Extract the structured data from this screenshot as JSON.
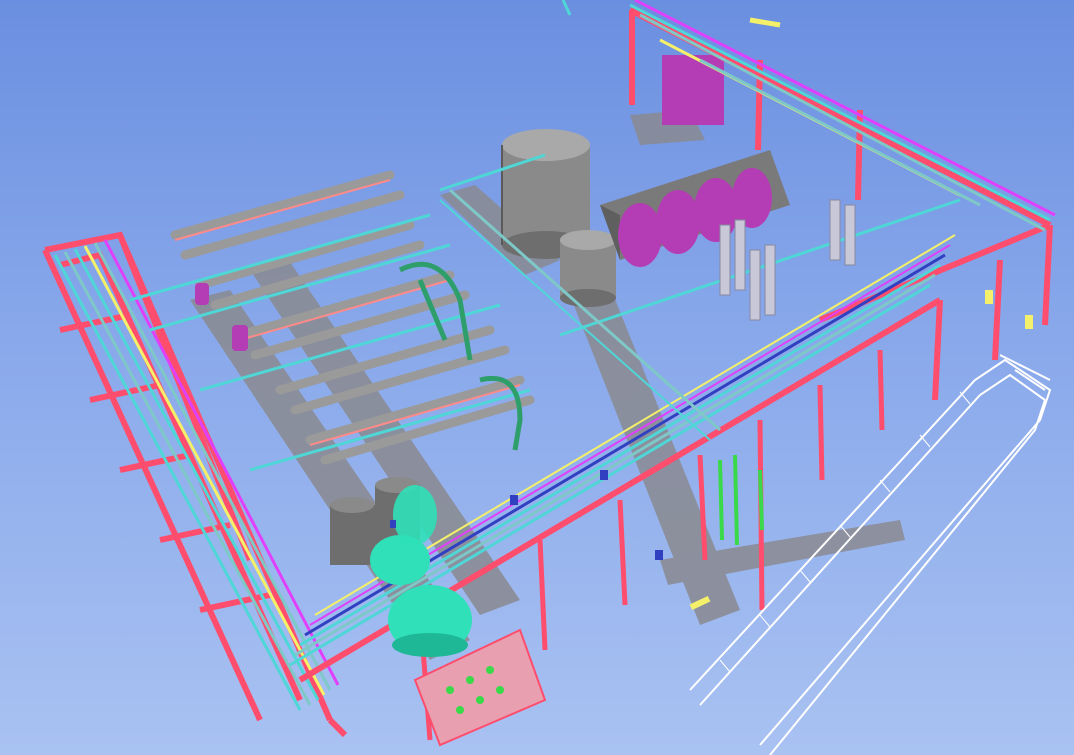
{
  "scene": {
    "description_hidden": "",
    "colors": {
      "background_top": "#6b8fe0",
      "background_bottom": "#a9c2f2",
      "steel_structure": "#ff4d6d",
      "pipe_cyan": "#4fd6d6",
      "pipe_teal": "#7ec8c8",
      "pipe_magenta": "#e040fb",
      "pipe_yellow": "#f5f06a",
      "pipe_green": "#3ad94a",
      "pipe_blue": "#3040c0",
      "tank_gray": "#8a8a8a",
      "tank_purple": "#b43cb4",
      "vessel_mint": "#2fe0b8",
      "walkway_white": "#ffffff",
      "grating_gray": "#8a8a90"
    }
  }
}
